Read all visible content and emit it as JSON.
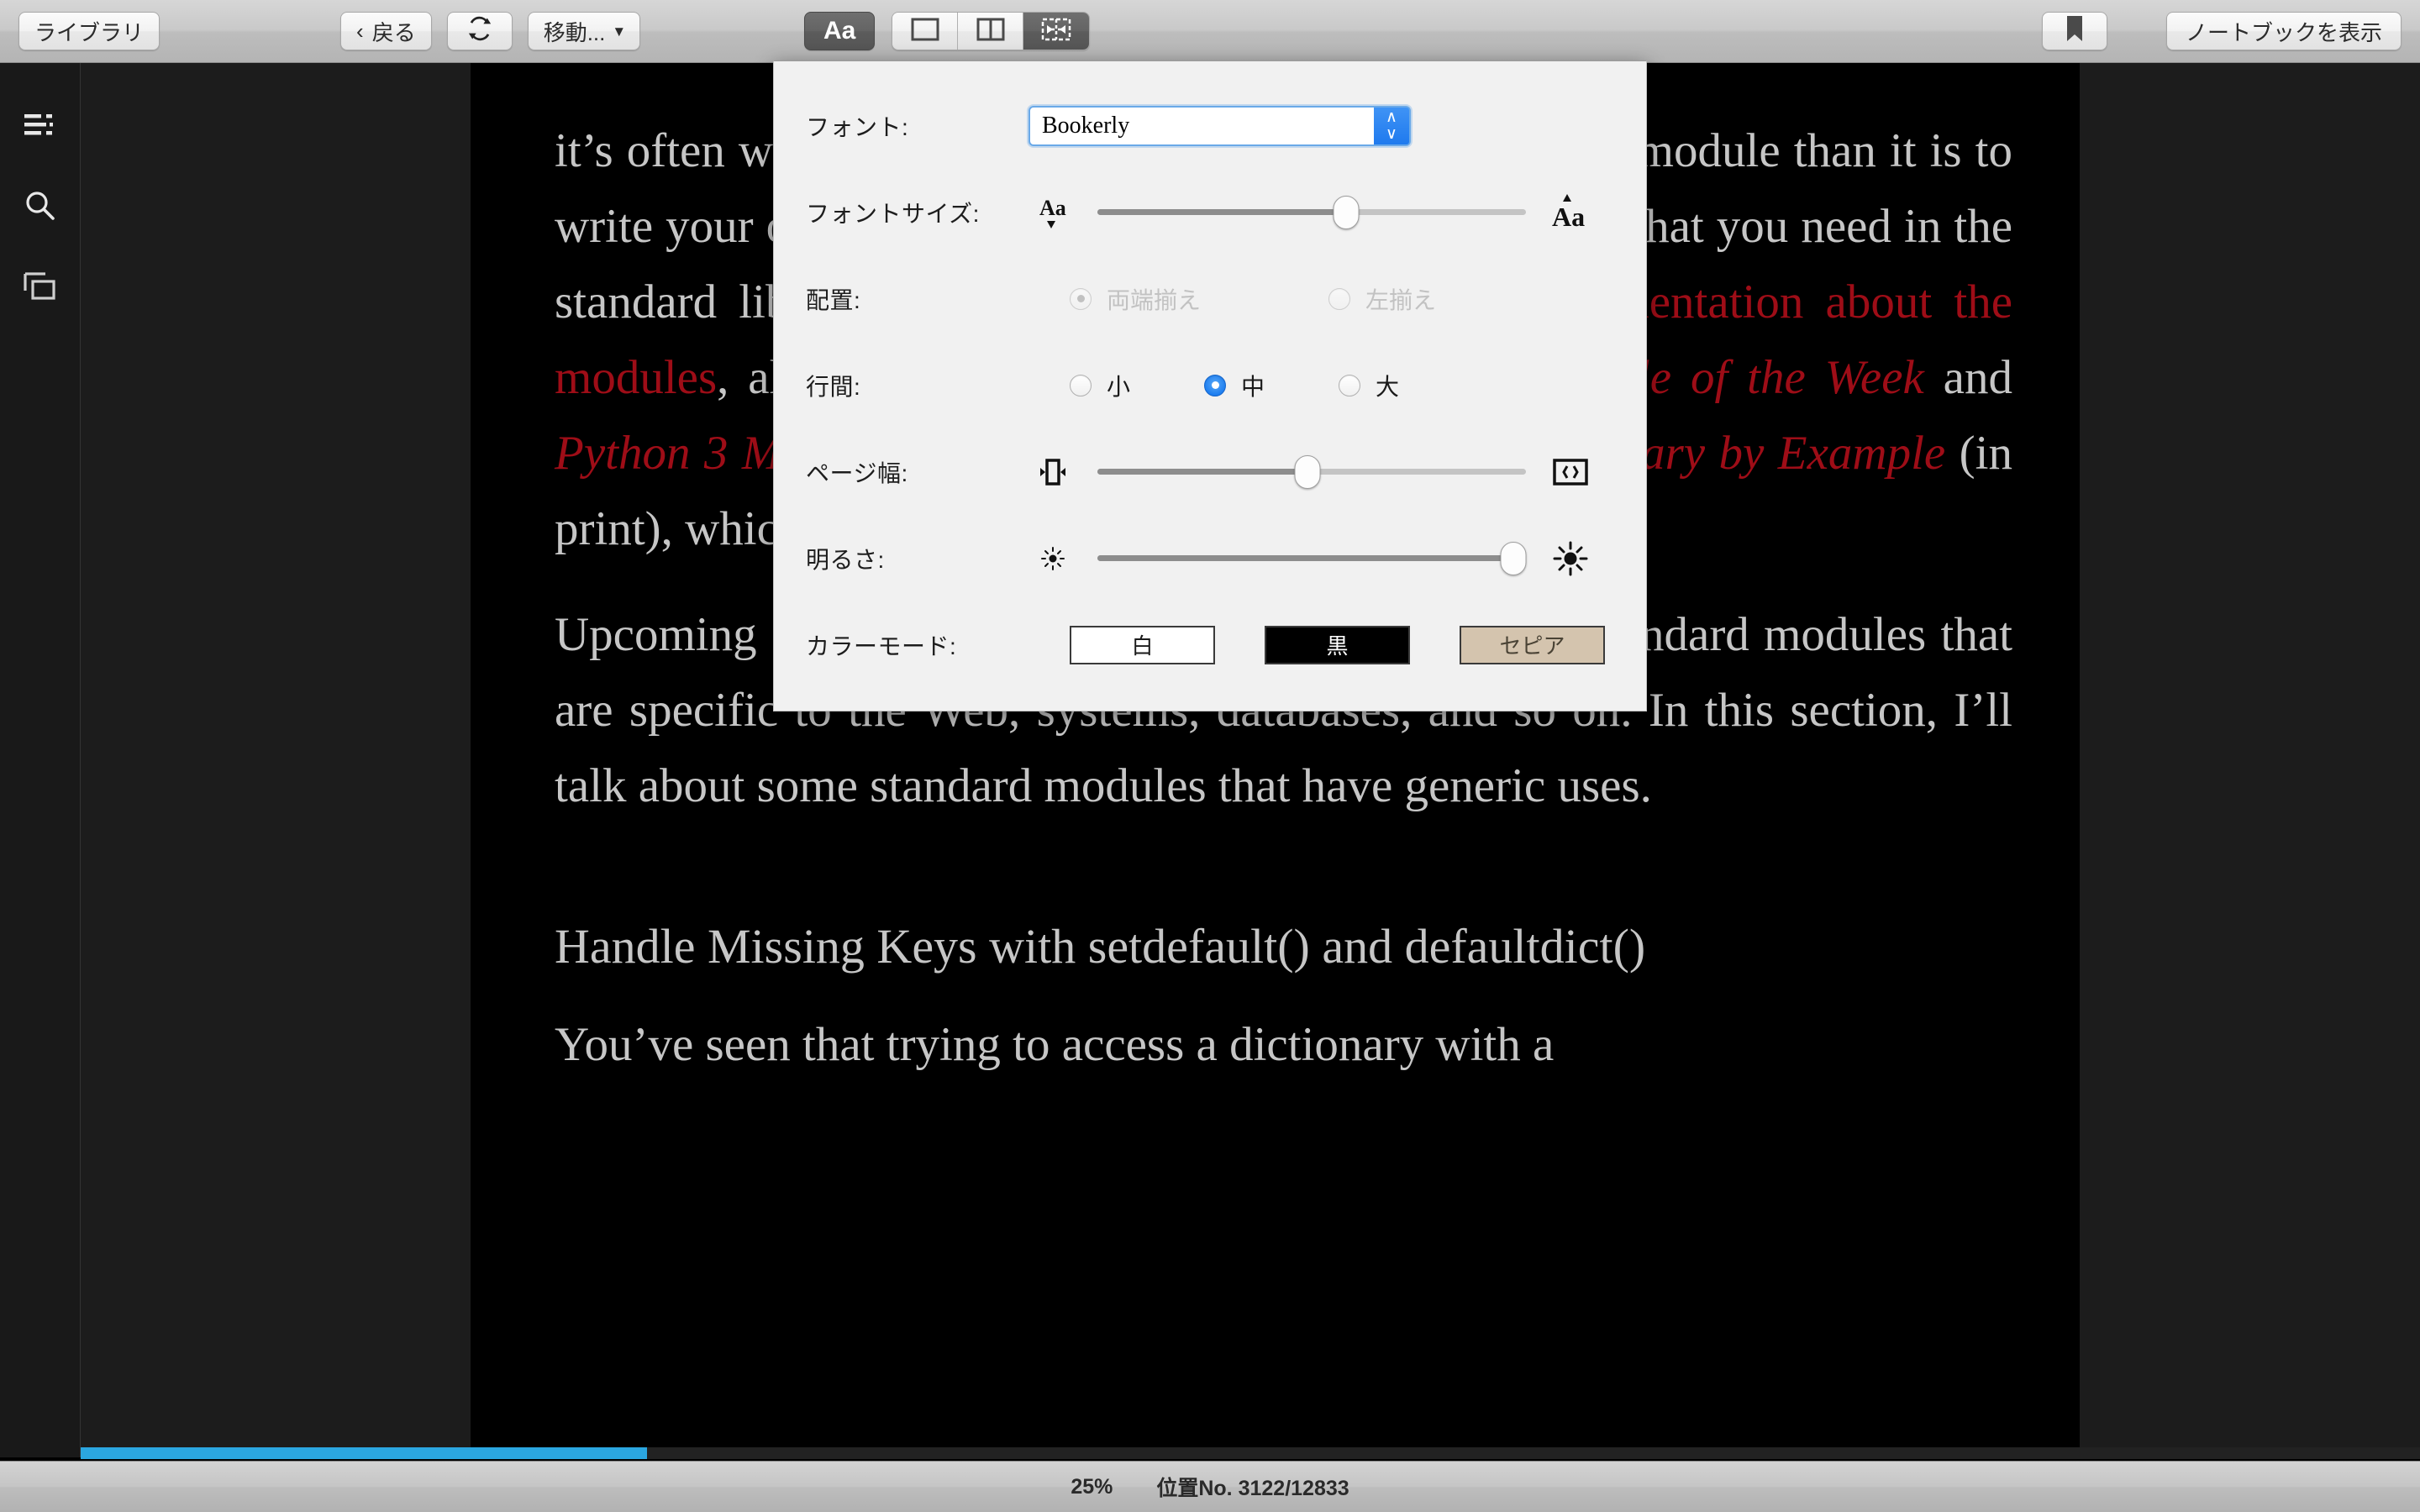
{
  "toolbar": {
    "library_label": "ライブラリ",
    "back_label": "戻る",
    "back_icon": "chevron-left-icon",
    "sync_icon": "sync-refresh-icon",
    "goto_label": "移動...",
    "goto_chevron": "chevron-down-icon",
    "aa_label": "Aa",
    "view_single_icon": "single-page-view-icon",
    "view_double_icon": "two-column-view-icon",
    "view_continuous_icon": "continuous-scroll-view-icon",
    "bookmark_icon": "bookmark-icon",
    "notebook_label": "ノートブックを表示"
  },
  "sidebar": {
    "items": [
      {
        "name": "table-of-contents",
        "icon": "list-lines-icon"
      },
      {
        "name": "search",
        "icon": "magnifier-icon"
      },
      {
        "name": "flashcards",
        "icon": "cards-stack-icon"
      }
    ]
  },
  "settings": {
    "font": {
      "label": "フォント:",
      "value": "Bookerly",
      "stepper_up": "∧",
      "stepper_down": "∨"
    },
    "font_size": {
      "label": "フォントサイズ:",
      "icon_small": "decrease-font-size-icon",
      "icon_large": "increase-font-size-icon",
      "value_percent": 58
    },
    "alignment": {
      "label": "配置:",
      "disabled": true,
      "options": [
        {
          "label": "両端揃え",
          "selected": true
        },
        {
          "label": "左揃え",
          "selected": false
        }
      ]
    },
    "line_spacing": {
      "label": "行間:",
      "options": [
        {
          "label": "小",
          "selected": false
        },
        {
          "label": "中",
          "selected": true
        },
        {
          "label": "大",
          "selected": false
        }
      ]
    },
    "page_width": {
      "label": "ページ幅:",
      "icon_narrow": "narrow-page-icon",
      "icon_wide": "wide-page-icon",
      "value_percent": 49
    },
    "brightness": {
      "label": "明るさ:",
      "icon_dim": "brightness-low-icon",
      "icon_bright": "brightness-high-icon",
      "value_percent": 97
    },
    "color_mode": {
      "label": "カラーモード:",
      "options": [
        {
          "label": "白",
          "mode": "white",
          "color": "#ffffff"
        },
        {
          "label": "黒",
          "mode": "black",
          "color": "#000000",
          "selected": true
        },
        {
          "label": "セピア",
          "mode": "sepia",
          "color": "#d4c4ae"
        }
      ]
    }
  },
  "book": {
    "paragraph_1_pre": "it’s often way more useful to import and use a standard module than it is to write your own. It’s surprising how often you can find what you need in the standard library. Python also provides a lot of ",
    "paragraph_1_link1": "documentation about the modules",
    "paragraph_1_mid": ", along with a couple of books, ",
    "paragraph_1_link2": "Python Module of the Week",
    "paragraph_1_mid2": " and ",
    "paragraph_1_link3": "Python 3 Module of the Week",
    "paragraph_1_mid3": " and ",
    "paragraph_1_link4": "Python Standard Library by Example",
    "paragraph_1_post": " (in print), which are very useful guides.",
    "paragraph_2": "Upcoming chapters in this book feature many of the standard modules that are specific to the Web, systems, databases, and so on. In this section, I’ll talk about some standard modules that have generic uses.",
    "heading": "Handle Missing Keys with setdefault() and defaultdict()",
    "paragraph_3": "You’ve seen that trying to access a dictionary with a",
    "text_color": "#c6c6c6",
    "link_color": "#9e0d17",
    "background_color": "#000000"
  },
  "status": {
    "zoom_percent": "25%",
    "location": "位置No. 3122/12833",
    "progress_percent": 24.2
  }
}
